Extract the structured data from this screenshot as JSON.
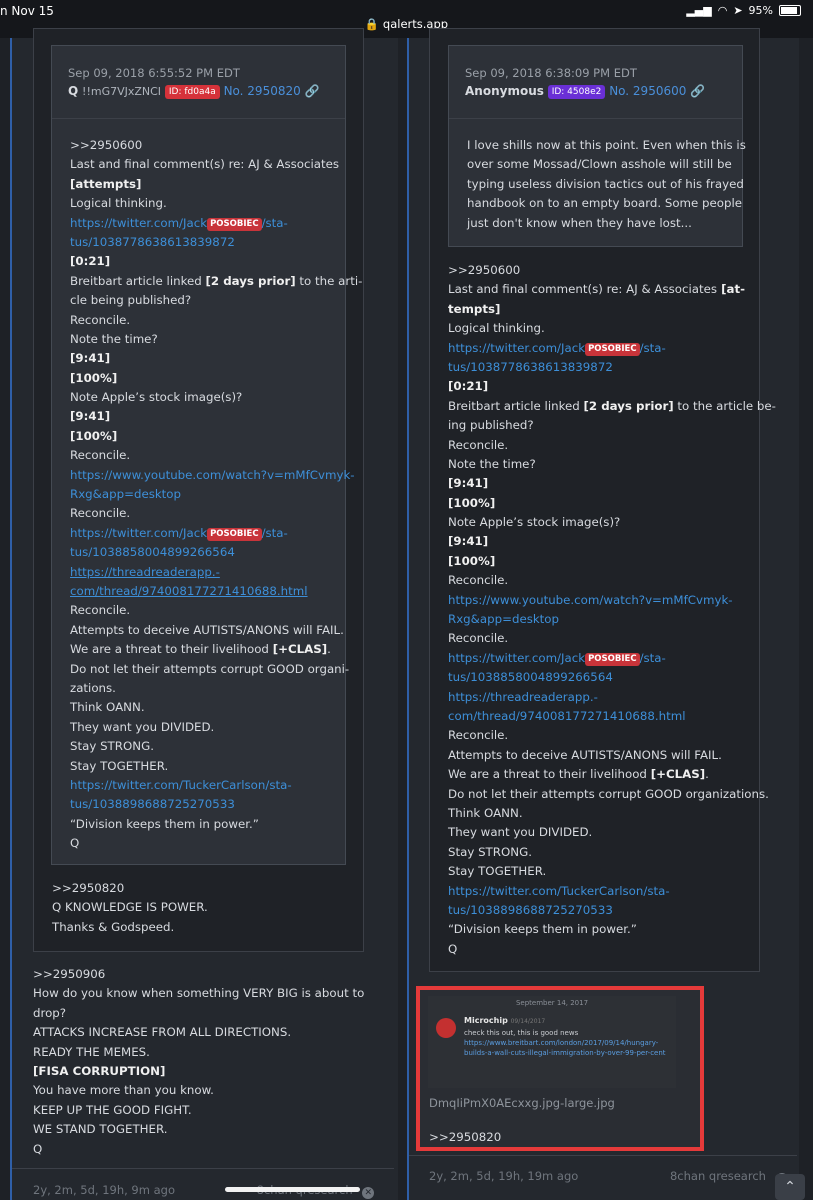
{
  "status_bar": {
    "time": "n Nov 15",
    "url": "qalerts.app",
    "battery": "95%"
  },
  "left_column": {
    "quoted_post": {
      "date": "Sep 09, 2018 6:55:52 PM EDT",
      "author": "Q",
      "tripcode": "!!mG7VJxZNCI",
      "id_badge": "ID: fd0a4a",
      "number": "No. 2950820",
      "inner_lines": [
        ">>2950600",
        "Last and final comment(s) re: AJ & Associates",
        "[attempts]",
        "Logical thinking.",
        "https://twitter.com/Jack",
        "tus/1038778638613839872",
        "[0:21]",
        "Breitbart article linked",
        "cle being published?",
        "Reconcile.",
        "Note the time?",
        "[9:41]",
        "[100%]",
        "Note Apple’s stock image(s)?",
        "[9:41]",
        "[100%]",
        "Reconcile.",
        "https://www.youtube.com/watch?v=mMfCvmyk-",
        "Rxg&app=desktop",
        "Reconcile.",
        "https://twitter.com/Jack",
        "tus/1038858004899266564",
        "https://threadreaderapp.-",
        "com/thread/974008177271410688.html",
        "Reconcile.",
        "Attempts to deceive AUTISTS/ANONS will FAIL.",
        "We are a threat to their livelihood",
        "Do not let their attempts corrupt GOOD organi-",
        "zations.",
        "Think OANN.",
        "They want you DIVIDED.",
        "Stay STRONG.",
        "Stay TOGETHER.",
        "https://twitter.com/TuckerCarlson/sta-",
        "tus/1038898688725270533",
        "“Division keeps them in power.”",
        "Q"
      ],
      "redacted": "POSOBIEC",
      "sta_suffix": "/sta-",
      "two_days_prior": "[2 days prior]",
      "to_the_arti": " to the arti-",
      "clas": "[+CLAS]",
      "period": ".",
      "reply_lines": [
        ">>2950820",
        "Q KNOWLEDGE IS POWER.",
        "Thanks & Godspeed."
      ]
    },
    "main_lines": [
      ">>2950906",
      "How do you know when something VERY BIG is about to",
      "drop?",
      "ATTACKS INCREASE FROM ALL DIRECTIONS.",
      "READY THE MEMES.",
      "[FISA CORRUPTION]",
      "You have more than you know.",
      "KEEP UP THE GOOD FIGHT.",
      "WE STAND TOGETHER.",
      "Q"
    ],
    "footer": "2y, 2m, 5d, 19h, 9m ago",
    "footer_source": "8chan qresearch"
  },
  "right_column": {
    "quoted_post": {
      "date": "Sep 09, 2018 6:38:09 PM EDT",
      "author": "Anonymous",
      "id_badge": "ID: 4508e2",
      "number": "No. 2950600",
      "lines": [
        "I love shills now at this point. Even when this is",
        "over some Mossad/Clown asshole will still be",
        "typing useless division tactics out of his frayed",
        "handbook on to an empty board. Some people",
        "just don't know when they have lost..."
      ]
    },
    "body_lines": [
      ">>2950600",
      "Last and final comment(s) re: AJ & Associates",
      "tempts]",
      "Logical thinking.",
      "https://twitter.com/Jack",
      "tus/1038778638613839872",
      "[0:21]",
      "Breitbart article linked",
      "ing published?",
      "Reconcile.",
      "Note the time?",
      "[9:41]",
      "[100%]",
      "Note Apple’s stock image(s)?",
      "[9:41]",
      "[100%]",
      "Reconcile.",
      "https://www.youtube.com/watch?v=mMfCvmyk-",
      "Rxg&app=desktop",
      "Reconcile.",
      "https://twitter.com/Jack",
      "tus/1038858004899266564",
      "https://threadreaderapp.-",
      "com/thread/974008177271410688.html",
      "Reconcile.",
      "Attempts to deceive AUTISTS/ANONS will FAIL.",
      "We are a threat to their livelihood",
      "Do not let their attempts corrupt GOOD organizations.",
      "Think OANN.",
      "They want you DIVIDED.",
      "Stay STRONG.",
      "Stay TOGETHER.",
      "https://twitter.com/TuckerCarlson/sta-",
      "tus/1038898688725270533",
      "“Division keeps them in power.”",
      "Q"
    ],
    "at_bracket": " [at-",
    "redacted": "POSOBIEC",
    "sta_suffix": "/sta-",
    "two_days_prior": "[2 days prior]",
    "to_the_article": " to the article be-",
    "clas": "[+CLAS]",
    "period": ".",
    "attachment": {
      "screenshot_date": "September 14, 2017",
      "screenshot_user": "Microchip",
      "screenshot_user_date": "09/14/2017",
      "screenshot_text": "check this out, this is good news",
      "screenshot_link": "https://www.breitbart.com/london/2017/09/14/hungary-builds-a-wall-cuts-illegal-immigration-by-over-99-per-cent",
      "filename": "DmqIiPmX0AEcxxg.jpg-large.jpg",
      "reply": ">>2950820"
    },
    "footer": "2y, 2m, 5d, 19h, 19m ago",
    "footer_source": "8chan qresearch"
  }
}
